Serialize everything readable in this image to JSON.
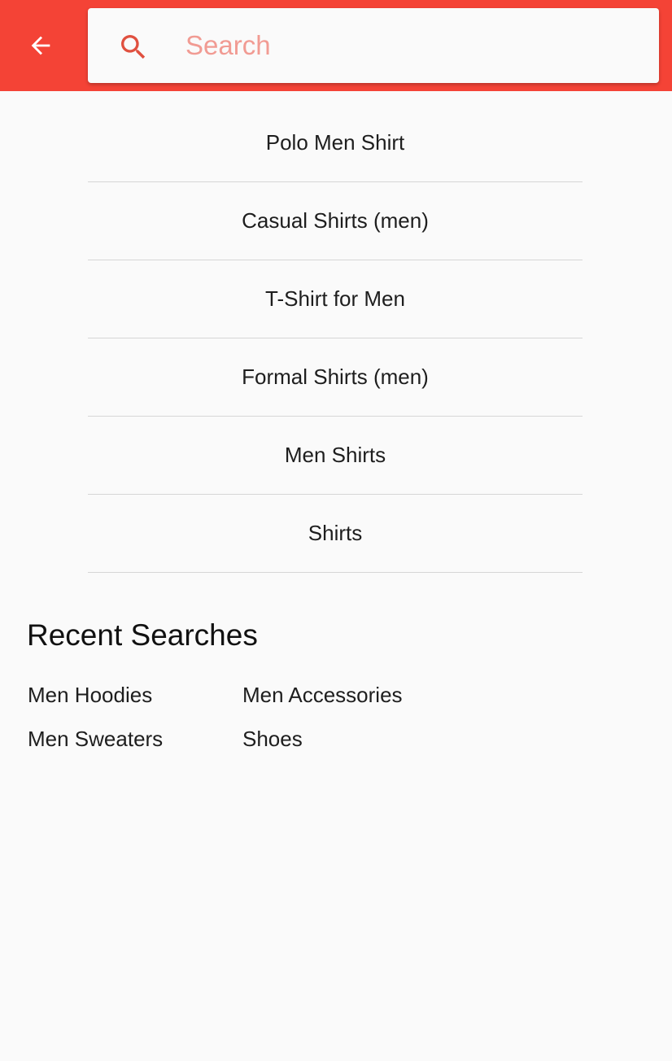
{
  "header": {
    "back_icon": "arrow-left-icon",
    "accent_color": "#f44336"
  },
  "search": {
    "icon": "search-icon",
    "placeholder": "Search",
    "value": ""
  },
  "suggestions": [
    "Polo Men Shirt",
    "Casual Shirts (men)",
    "T-Shirt for Men",
    "Formal Shirts (men)",
    "Men Shirts",
    "Shirts"
  ],
  "recent": {
    "title": "Recent Searches",
    "items": [
      "Men Hoodies",
      "Men Accessories",
      "Men Sweaters",
      "Shoes"
    ]
  }
}
